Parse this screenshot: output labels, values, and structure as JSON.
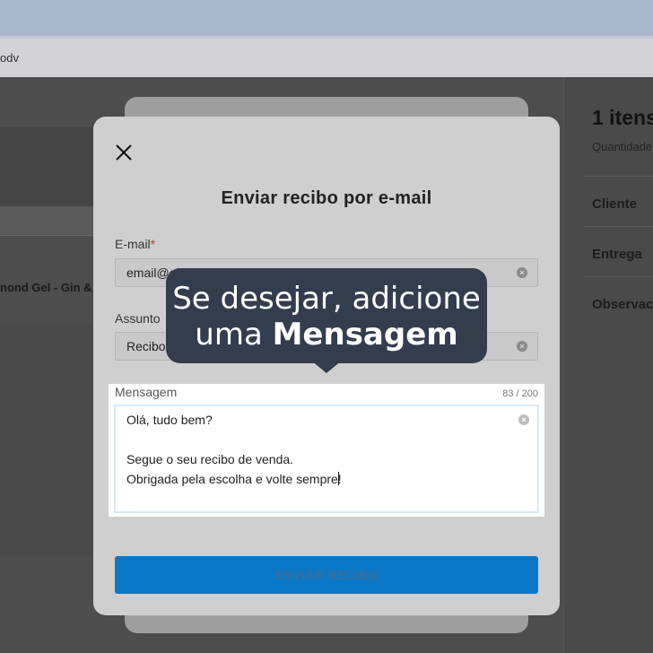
{
  "browser": {
    "address_partial": "odv"
  },
  "background_page": {
    "left_product_text": "nond Gel - Gin &",
    "summary_title": "1 itens",
    "summary_subtitle": "Quantidade",
    "sections": [
      "Cliente",
      "Entrega",
      "Observac"
    ]
  },
  "modal": {
    "title": "Enviar recibo por e-mail",
    "email": {
      "label": "E-mail",
      "required_mark": "*",
      "value": "email@el"
    },
    "subject": {
      "label": "Assunto",
      "value": "Recibo"
    },
    "message": {
      "label": "Mensagem",
      "counter": "83 / 200",
      "lines": [
        "Olá, tudo bem?",
        "",
        "Segue o seu recibo de venda.",
        "Obrigada pela escolha e volte sempre!"
      ]
    },
    "send_label": "ENVIAR RECIBO",
    "clear_glyph": "×"
  },
  "tooltip": {
    "line1": "Se desejar, adicione",
    "line2_prefix": "uma ",
    "line2_strong": "Mensagem"
  },
  "colors": {
    "primary_button": "#0a78c8",
    "tooltip_bg": "#333d4e",
    "required": "#b23b3b"
  }
}
